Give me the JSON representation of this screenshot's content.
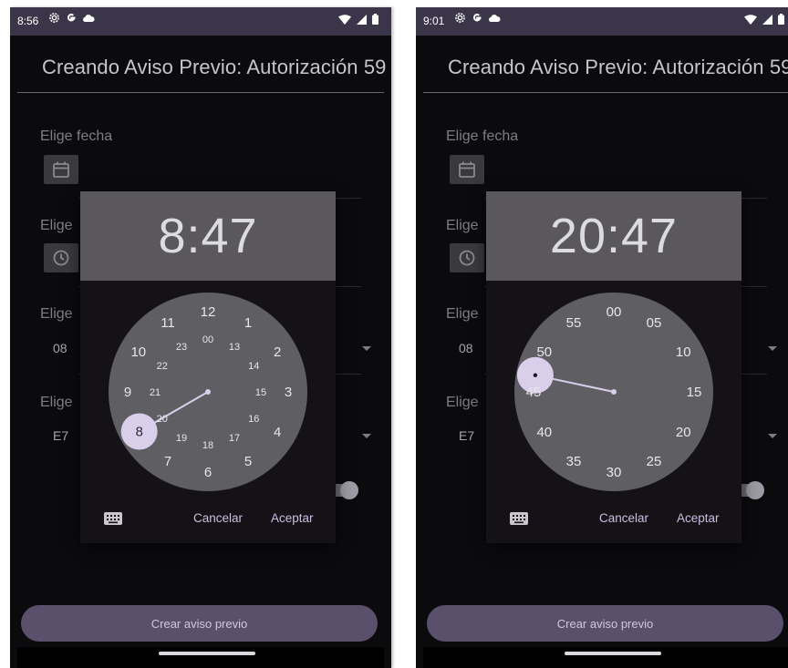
{
  "screens": [
    {
      "status_time": "8:56",
      "title": "Creando Aviso Previo: Autorización 59",
      "labels": {
        "date": "Elige fecha",
        "time": "Elige",
        "third": "Elige",
        "fourth": "Elige"
      },
      "dropdown1_value": "08",
      "dropdown2_value": "E7",
      "create_button": "Crear aviso previo",
      "picker": {
        "mode": "hours",
        "time": "8:47",
        "selected": "8",
        "outer_numbers": [
          "12",
          "1",
          "2",
          "3",
          "4",
          "5",
          "6",
          "7",
          "8",
          "9",
          "10",
          "11"
        ],
        "inner_numbers": [
          "00",
          "13",
          "14",
          "15",
          "16",
          "17",
          "18",
          "19",
          "20",
          "21",
          "22",
          "23"
        ],
        "cancel": "Cancelar",
        "accept": "Aceptar"
      }
    },
    {
      "status_time": "9:01",
      "title": "Creando Aviso Previo: Autorización 59",
      "labels": {
        "date": "Elige fecha",
        "time": "Elige",
        "third": "Elige",
        "fourth": "Elige"
      },
      "dropdown1_value": "08",
      "dropdown2_value": "E7",
      "create_button": "Crear aviso previo",
      "picker": {
        "mode": "minutes",
        "time": "20:47",
        "selected": "47",
        "outer_numbers": [
          "00",
          "05",
          "10",
          "15",
          "20",
          "25",
          "30",
          "35",
          "40",
          "45",
          "50",
          "55"
        ],
        "cancel": "Cancelar",
        "accept": "Aceptar"
      }
    }
  ],
  "colors": {
    "background": "#0b0a0d",
    "status_bar": "#3b3549",
    "dialog_header": "#5a585d",
    "clock_face": "#5f5e63",
    "selector": "#d9cfeb",
    "accent_text": "#c9bfe0",
    "primary_button": "#5b506c"
  },
  "icons": {
    "status": [
      "settings-icon",
      "google-icon",
      "cloud-icon",
      "wifi-icon",
      "signal-icon",
      "battery-icon"
    ],
    "calendar": "calendar-icon",
    "clock": "clock-icon",
    "keyboard": "keyboard-icon"
  }
}
